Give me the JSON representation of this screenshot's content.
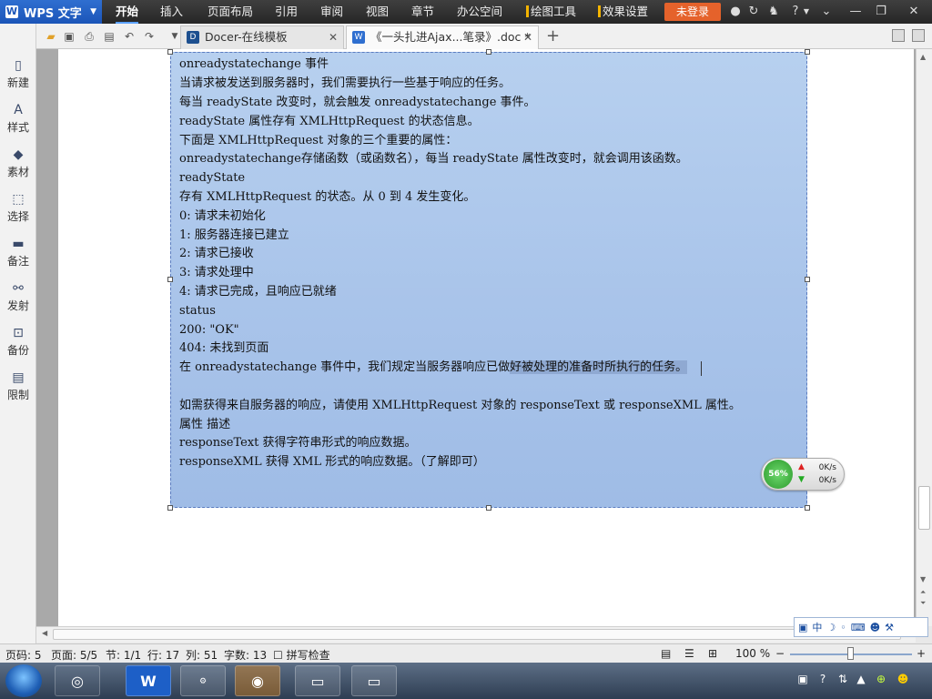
{
  "app": {
    "name": "WPS 文字",
    "logo": "W"
  },
  "menus": [
    "开始",
    "插入",
    "页面布局",
    "引用",
    "审阅",
    "视图",
    "章节",
    "办公空间",
    "绘图工具",
    "效果设置"
  ],
  "login_label": "未登录",
  "tabs": [
    {
      "label": "Docer-在线模板",
      "active": false
    },
    {
      "label": "《一头扎进Ajax...笔录》.doc *",
      "active": true
    }
  ],
  "sidebar": [
    {
      "label": "新建",
      "icon": "new-doc-icon"
    },
    {
      "label": "样式",
      "icon": "style-icon"
    },
    {
      "label": "素材",
      "icon": "material-icon"
    },
    {
      "label": "选择",
      "icon": "select-icon"
    },
    {
      "label": "备注",
      "icon": "comment-icon"
    },
    {
      "label": "发射",
      "icon": "link-icon"
    },
    {
      "label": "备份",
      "icon": "backup-icon"
    },
    {
      "label": "限制",
      "icon": "restrict-icon"
    }
  ],
  "document": {
    "lines": [
      "onreadystatechange  事件",
      "当请求被发送到服务器时，我们需要执行一些基于响应的任务。",
      "每当  readyState  改变时，就会触发  onreadystatechange  事件。",
      "readyState  属性存有  XMLHttpRequest  的状态信息。",
      "下面是  XMLHttpRequest  对象的三个重要的属性：",
      "onreadystatechange存储函数（或函数名），每当  readyState  属性改变时，就会调用该函数。",
      "readyState",
      "存有  XMLHttpRequest  的状态。从  0  到  4  发生变化。",
      "0:  请求未初始化",
      "1:  服务器连接已建立",
      "2:  请求已接收",
      "3:  请求处理中",
      "4:  请求已完成，且响应已就绪",
      "status",
      "200: \"OK\"",
      "404:  未找到页面",
      "",
      "",
      "如需获得来自服务器的响应，请使用  XMLHttpRequest  对象的  responseText  或  responseXML  属性。",
      "属性        描述",
      "responseText    获得字符串形式的响应数据。",
      "responseXML  获得  XML  形式的响应数据。（了解即可）"
    ],
    "line16_plain": "在  onreadystatechange  事件中，我们规定当服务器响应已做",
    "line16_highlight": "好被处理的准备时所执行的任务。"
  },
  "net_widget": {
    "percent": "56%",
    "up": "0K/s",
    "down": "0K/s"
  },
  "ime": {
    "mode": "中"
  },
  "status": {
    "page_no": "页码: 5",
    "pages": "页面: 5/5",
    "section": "节: 1/1",
    "row": "行: 17",
    "col": "列: 51",
    "words": "字数: 13",
    "spellcheck": "拼写检查",
    "zoom": "100 %"
  },
  "colors": {
    "accent": "#1b55b8",
    "login": "#e5622b",
    "selection": "#a9c4ea"
  }
}
